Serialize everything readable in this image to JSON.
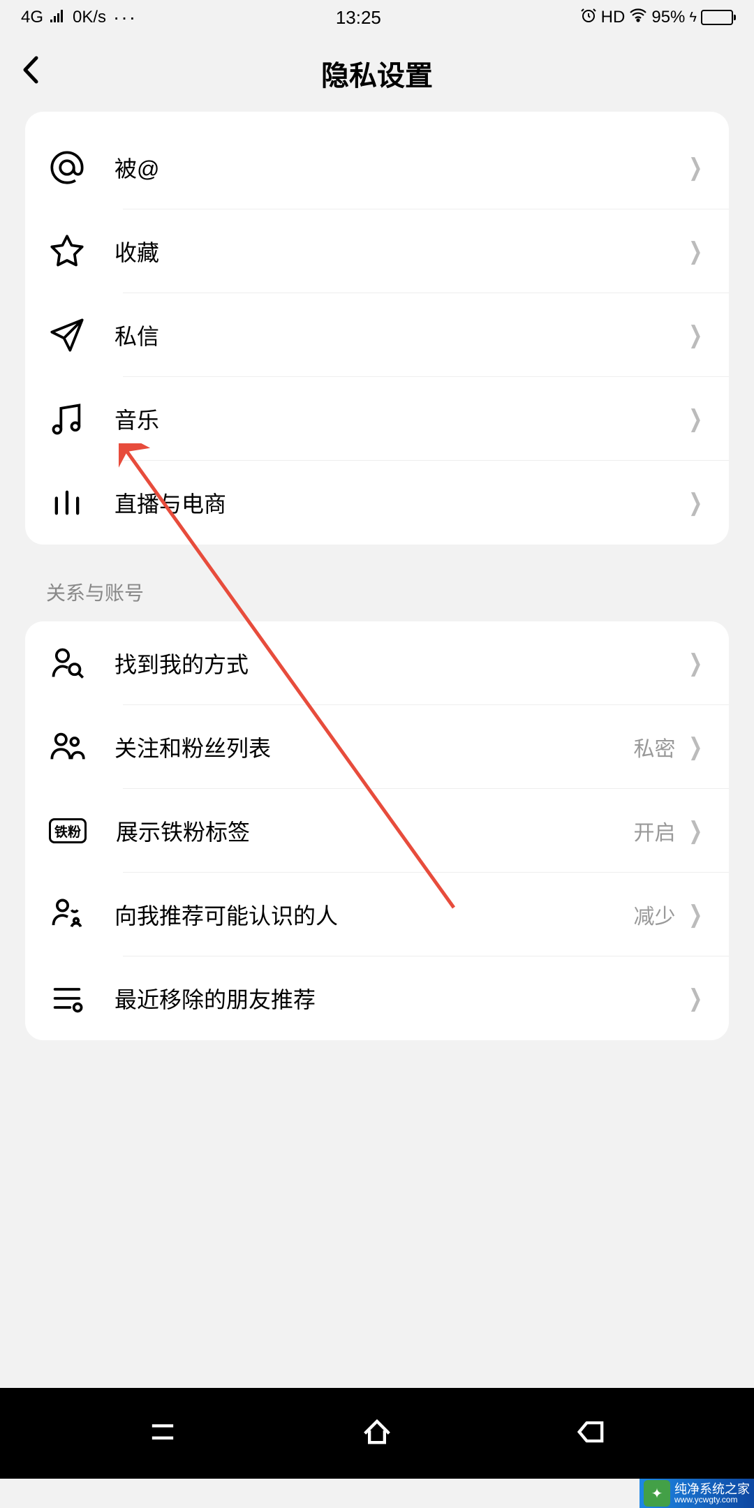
{
  "status": {
    "network": "4G",
    "speed": "0K/s",
    "dots": "···",
    "time": "13:25",
    "clock_icon": "⏰",
    "hd": "HD",
    "wifi": "wifi",
    "battery": "95%",
    "charge": "ϟ"
  },
  "header": {
    "title": "隐私设置"
  },
  "section1": {
    "rows": [
      {
        "icon": "at",
        "label": "被@"
      },
      {
        "icon": "star",
        "label": "收藏"
      },
      {
        "icon": "plane",
        "label": "私信"
      },
      {
        "icon": "music",
        "label": "音乐"
      },
      {
        "icon": "bars",
        "label": "直播与电商"
      }
    ]
  },
  "section2": {
    "title": "关系与账号",
    "rows": [
      {
        "icon": "person-search",
        "label": "找到我的方式",
        "value": ""
      },
      {
        "icon": "group",
        "label": "关注和粉丝列表",
        "value": "私密"
      },
      {
        "icon": "badge",
        "label": "展示铁粉标签",
        "value": "开启"
      },
      {
        "icon": "people-plus",
        "label": "向我推荐可能认识的人",
        "value": "减少"
      },
      {
        "icon": "history",
        "label": "最近移除的朋友推荐",
        "value": ""
      }
    ]
  },
  "watermark": {
    "line1": "纯净系统之家",
    "line2": "www.ycwgty.com"
  },
  "icon_badge_text": "铁粉"
}
